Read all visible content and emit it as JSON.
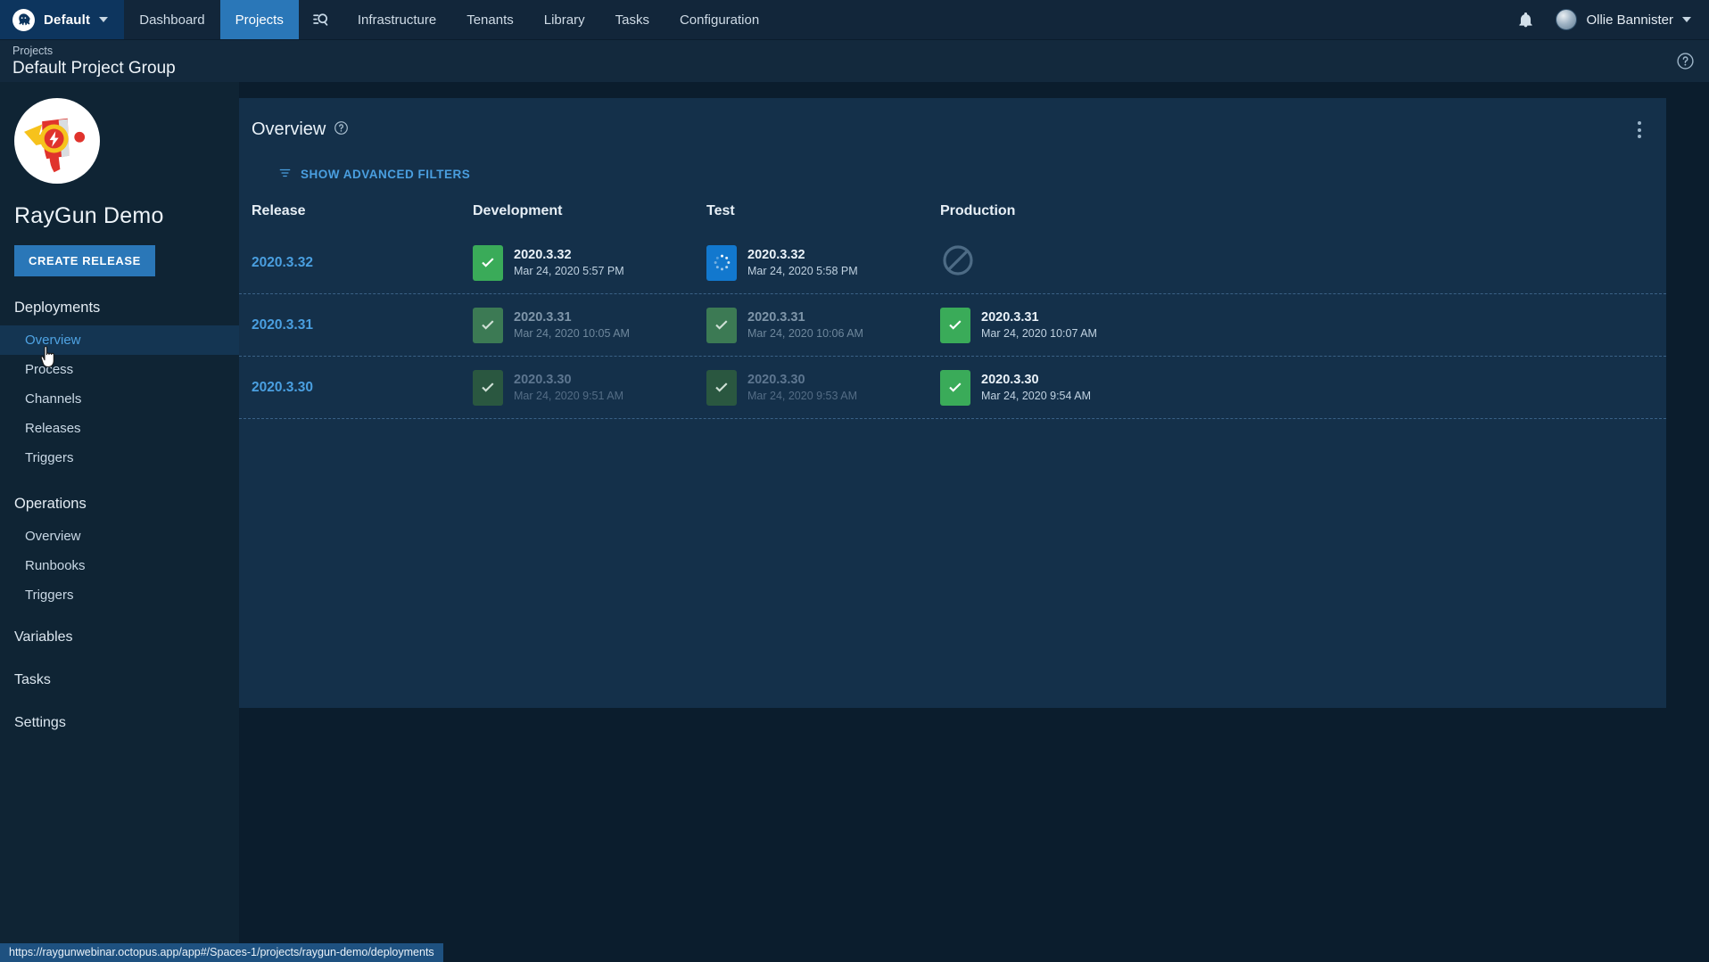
{
  "topnav": {
    "space": {
      "label": "Default",
      "logo_icon": "octopus-logo-icon",
      "caret_icon": "chevron-down-icon"
    },
    "items": [
      {
        "label": "Dashboard",
        "name": "nav-dashboard",
        "active": false
      },
      {
        "label": "Projects",
        "name": "nav-projects",
        "active": true
      }
    ],
    "search_icon": "search-icon",
    "items_after": [
      {
        "label": "Infrastructure",
        "name": "nav-infrastructure"
      },
      {
        "label": "Tenants",
        "name": "nav-tenants"
      },
      {
        "label": "Library",
        "name": "nav-library"
      },
      {
        "label": "Tasks",
        "name": "nav-tasks"
      },
      {
        "label": "Configuration",
        "name": "nav-configuration"
      }
    ],
    "notifications_icon": "bell-icon",
    "user": {
      "name": "Ollie Bannister",
      "avatar_icon": "avatar",
      "caret_icon": "chevron-down-icon"
    }
  },
  "pagehead": {
    "breadcrumb": "Projects",
    "title": "Default Project Group",
    "help_icon": "help-circle-icon"
  },
  "sidebar": {
    "project_name": "RayGun Demo",
    "logo_icon": "raygun-logo-icon",
    "create_release_label": "CREATE RELEASE",
    "groups": [
      {
        "title": "Deployments",
        "items": [
          {
            "label": "Overview",
            "name": "sidebar-item-deployments-overview",
            "active": true
          },
          {
            "label": "Process",
            "name": "sidebar-item-process",
            "active": false
          },
          {
            "label": "Channels",
            "name": "sidebar-item-channels",
            "active": false
          },
          {
            "label": "Releases",
            "name": "sidebar-item-releases",
            "active": false
          },
          {
            "label": "Triggers",
            "name": "sidebar-item-deployment-triggers",
            "active": false
          }
        ]
      },
      {
        "title": "Operations",
        "items": [
          {
            "label": "Overview",
            "name": "sidebar-item-operations-overview",
            "active": false
          },
          {
            "label": "Runbooks",
            "name": "sidebar-item-runbooks",
            "active": false
          },
          {
            "label": "Triggers",
            "name": "sidebar-item-operations-triggers",
            "active": false
          }
        ]
      }
    ],
    "standalone": [
      {
        "label": "Variables",
        "name": "sidebar-item-variables"
      },
      {
        "label": "Tasks",
        "name": "sidebar-item-tasks"
      },
      {
        "label": "Settings",
        "name": "sidebar-item-settings"
      }
    ]
  },
  "panel": {
    "title": "Overview",
    "help_icon": "help-circle-icon",
    "kebab_icon": "more-vertical-icon",
    "filters_label": "SHOW ADVANCED FILTERS",
    "filters_icon": "filter-icon",
    "columns": [
      "Release",
      "Development",
      "Test",
      "Production"
    ],
    "rows": [
      {
        "release": "2020.3.32",
        "cells": [
          {
            "state": "success",
            "icon": "check-icon",
            "version": "2020.3.32",
            "when": "Mar 24, 2020 5:57 PM",
            "fade": "none"
          },
          {
            "state": "running",
            "icon": "spinner-icon",
            "version": "2020.3.32",
            "when": "Mar 24, 2020 5:58 PM",
            "fade": "none"
          },
          {
            "state": "blocked",
            "icon": "blocked-icon",
            "version": "",
            "when": "",
            "fade": "none"
          }
        ]
      },
      {
        "release": "2020.3.31",
        "cells": [
          {
            "state": "dim1",
            "icon": "check-icon",
            "version": "2020.3.31",
            "when": "Mar 24, 2020 10:05 AM",
            "fade": "faded1"
          },
          {
            "state": "dim1",
            "icon": "check-icon",
            "version": "2020.3.31",
            "when": "Mar 24, 2020 10:06 AM",
            "fade": "faded1"
          },
          {
            "state": "success",
            "icon": "check-icon",
            "version": "2020.3.31",
            "when": "Mar 24, 2020 10:07 AM",
            "fade": "none"
          }
        ]
      },
      {
        "release": "2020.3.30",
        "cells": [
          {
            "state": "dim2",
            "icon": "check-icon",
            "version": "2020.3.30",
            "when": "Mar 24, 2020 9:51 AM",
            "fade": "faded2"
          },
          {
            "state": "dim2",
            "icon": "check-icon",
            "version": "2020.3.30",
            "when": "Mar 24, 2020 9:53 AM",
            "fade": "faded2"
          },
          {
            "state": "success",
            "icon": "check-icon",
            "version": "2020.3.30",
            "when": "Mar 24, 2020 9:54 AM",
            "fade": "none"
          }
        ]
      }
    ]
  },
  "statusbar": {
    "url": "https://raygunwebinar.octopus.app/app#/Spaces-1/projects/raygun-demo/deployments"
  },
  "colors": {
    "accent_blue": "#2a77b8",
    "link_blue": "#4a9fe0",
    "success_green": "#3aab59",
    "running_blue": "#1278ce",
    "panel_bg": "#14304a",
    "page_bg": "#0b1d2d",
    "sidebar_bg": "#0f2434",
    "topnav_bg": "#12263a"
  }
}
